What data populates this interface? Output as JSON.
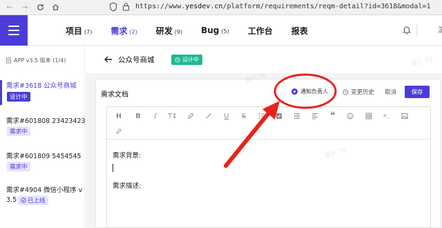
{
  "browser": {
    "url_prefix": "https://www.",
    "url_host": "yesdev.cn",
    "url_path": "/platform/requirements/reqm-detail?id=3618&modal=1"
  },
  "header": {
    "nav": [
      {
        "label": "项目",
        "count": "(7)",
        "active": false
      },
      {
        "label": "需求",
        "count": "(2)",
        "active": true
      },
      {
        "label": "研发",
        "count": "(9)",
        "active": false
      },
      {
        "label": "Bug",
        "count": "(5)",
        "active": false
      },
      {
        "label": "工作台",
        "count": "",
        "active": false
      },
      {
        "label": "报表",
        "count": "",
        "active": false
      }
    ],
    "right_text": "演"
  },
  "sidebar": {
    "project": "APP v3.5 版本 (1/4)",
    "items": [
      {
        "title": "需求#3618 公众号商城",
        "badge": "设计中",
        "badge_style": "solid",
        "active": true
      },
      {
        "title": "需求#601808 23423423",
        "badge": "需求中",
        "badge_style": "light",
        "active": false
      },
      {
        "title": "需求#601809 5454545",
        "badge": "需求中",
        "badge_style": "light",
        "active": false
      },
      {
        "title": "需求#4904 微信小程序 v",
        "title2": "3.5",
        "badge": "已上线",
        "badge_style": "light",
        "active": false
      }
    ]
  },
  "requirement": {
    "title": "公众号商城",
    "status": "设计中",
    "status_color": "#1db993"
  },
  "doc": {
    "title": "需求文档",
    "notify_label": "通知负责人",
    "history_label": "变更历史",
    "cancel_label": "取消",
    "save_label": "保存",
    "toolbar_icons": [
      "H",
      "B",
      "I",
      "T↕",
      "highlight",
      "brush",
      "U",
      "S",
      "bullet-list",
      "checkbox",
      "indent",
      "align",
      "quote",
      "emoji",
      "table",
      "code",
      "image",
      "link"
    ],
    "lines": [
      "需求背景:",
      "需求描述:"
    ]
  },
  "watermark": "演示 70",
  "accent": "#4b3cd8",
  "annotation_color": "#e8231a"
}
